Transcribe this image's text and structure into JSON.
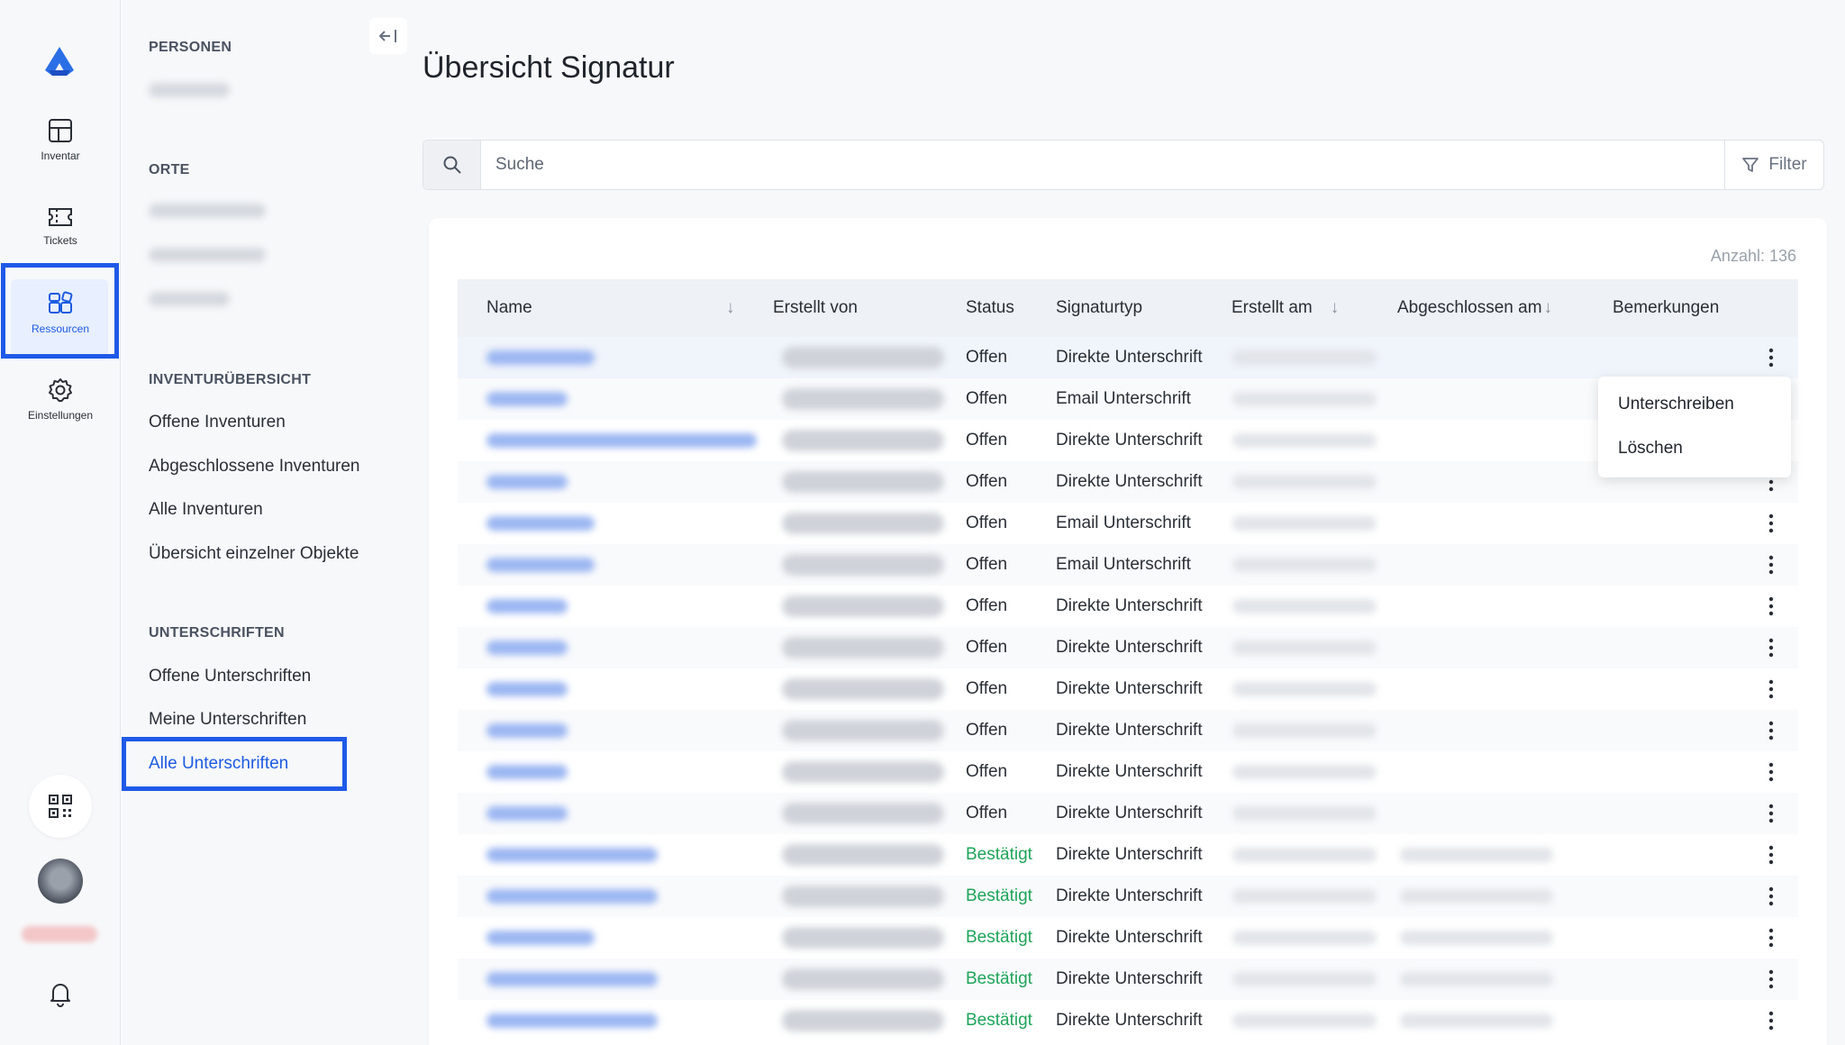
{
  "rail": {
    "items": [
      {
        "label": "Inventar",
        "icon": "layout-grid-icon"
      },
      {
        "label": "Tickets",
        "icon": "ticket-icon"
      },
      {
        "label": "Ressourcen",
        "icon": "resources-icon"
      },
      {
        "label": "Einstellungen",
        "icon": "gear-icon"
      }
    ]
  },
  "nav": {
    "sections": [
      {
        "title": "PERSONEN"
      },
      {
        "title": "ORTE"
      },
      {
        "title": "INVENTURÜBERSICHT",
        "items": [
          "Offene Inventuren",
          "Abgeschlossene Inventuren",
          "Alle Inventuren",
          "Übersicht einzelner Objekte"
        ]
      },
      {
        "title": "UNTERSCHRIFTEN",
        "items": [
          "Offene Unterschriften",
          "Meine Unterschriften",
          "Alle Unterschriften"
        ]
      }
    ]
  },
  "page": {
    "title": "Übersicht Signatur"
  },
  "search": {
    "placeholder": "Suche",
    "filter_label": "Filter"
  },
  "table": {
    "count_label": "Anzahl: 136",
    "headers": [
      "Name",
      "Erstellt von",
      "Status",
      "Signaturtyp",
      "Erstellt am",
      "Abgeschlossen am",
      "Bemerkungen"
    ],
    "rows": [
      {
        "status": "Offen",
        "type": "Direkte Unterschrift"
      },
      {
        "status": "Offen",
        "type": "Email Unterschrift"
      },
      {
        "status": "Offen",
        "type": "Direkte Unterschrift"
      },
      {
        "status": "Offen",
        "type": "Direkte Unterschrift"
      },
      {
        "status": "Offen",
        "type": "Email Unterschrift"
      },
      {
        "status": "Offen",
        "type": "Email Unterschrift"
      },
      {
        "status": "Offen",
        "type": "Direkte Unterschrift"
      },
      {
        "status": "Offen",
        "type": "Direkte Unterschrift"
      },
      {
        "status": "Offen",
        "type": "Direkte Unterschrift"
      },
      {
        "status": "Offen",
        "type": "Direkte Unterschrift"
      },
      {
        "status": "Offen",
        "type": "Direkte Unterschrift"
      },
      {
        "status": "Offen",
        "type": "Direkte Unterschrift"
      },
      {
        "status": "Bestätigt",
        "type": "Direkte Unterschrift"
      },
      {
        "status": "Bestätigt",
        "type": "Direkte Unterschrift"
      },
      {
        "status": "Bestätigt",
        "type": "Direkte Unterschrift"
      },
      {
        "status": "Bestätigt",
        "type": "Direkte Unterschrift"
      },
      {
        "status": "Bestätigt",
        "type": "Direkte Unterschrift"
      }
    ]
  },
  "context_menu": {
    "items": [
      "Unterschreiben",
      "Löschen"
    ]
  },
  "colors": {
    "accent": "#1d5be0",
    "highlight_frame": "#1f59e8",
    "status_ok": "#1fa45a"
  }
}
